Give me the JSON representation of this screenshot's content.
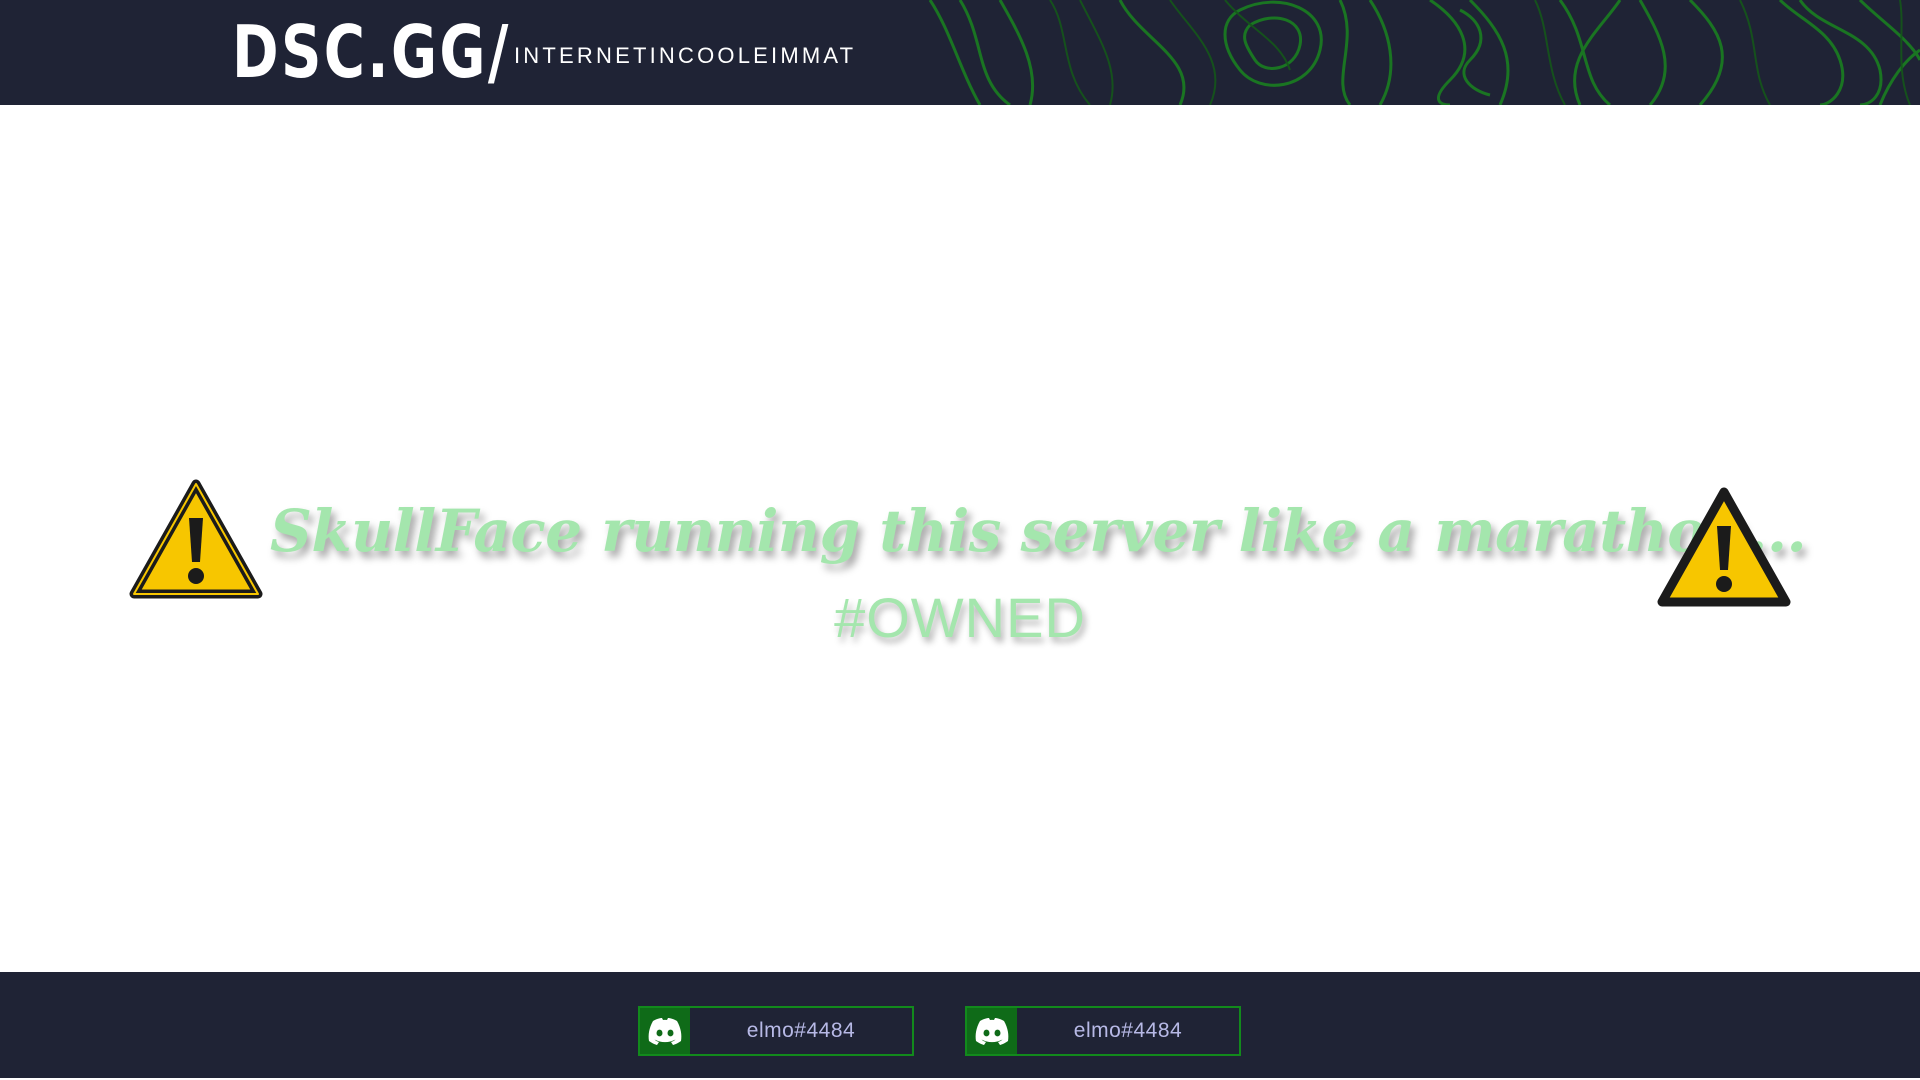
{
  "header": {
    "brand": "DSC.GG/",
    "slug": "INTERNETINCOOLEIMMAT",
    "background_color": "#1f2335",
    "accent_color": "#1a7a22"
  },
  "main": {
    "headline": "SkullFace running this server like a marathon...",
    "subline": "#OWNED",
    "text_color": "#a4e6ad",
    "left_icon": "warning-icon",
    "right_icon": "warning-icon"
  },
  "footer": {
    "tags": [
      {
        "icon": "discord-icon",
        "label": "elmo#4484"
      },
      {
        "icon": "discord-icon",
        "label": "elmo#4484"
      }
    ],
    "border_color": "#128a1c"
  }
}
